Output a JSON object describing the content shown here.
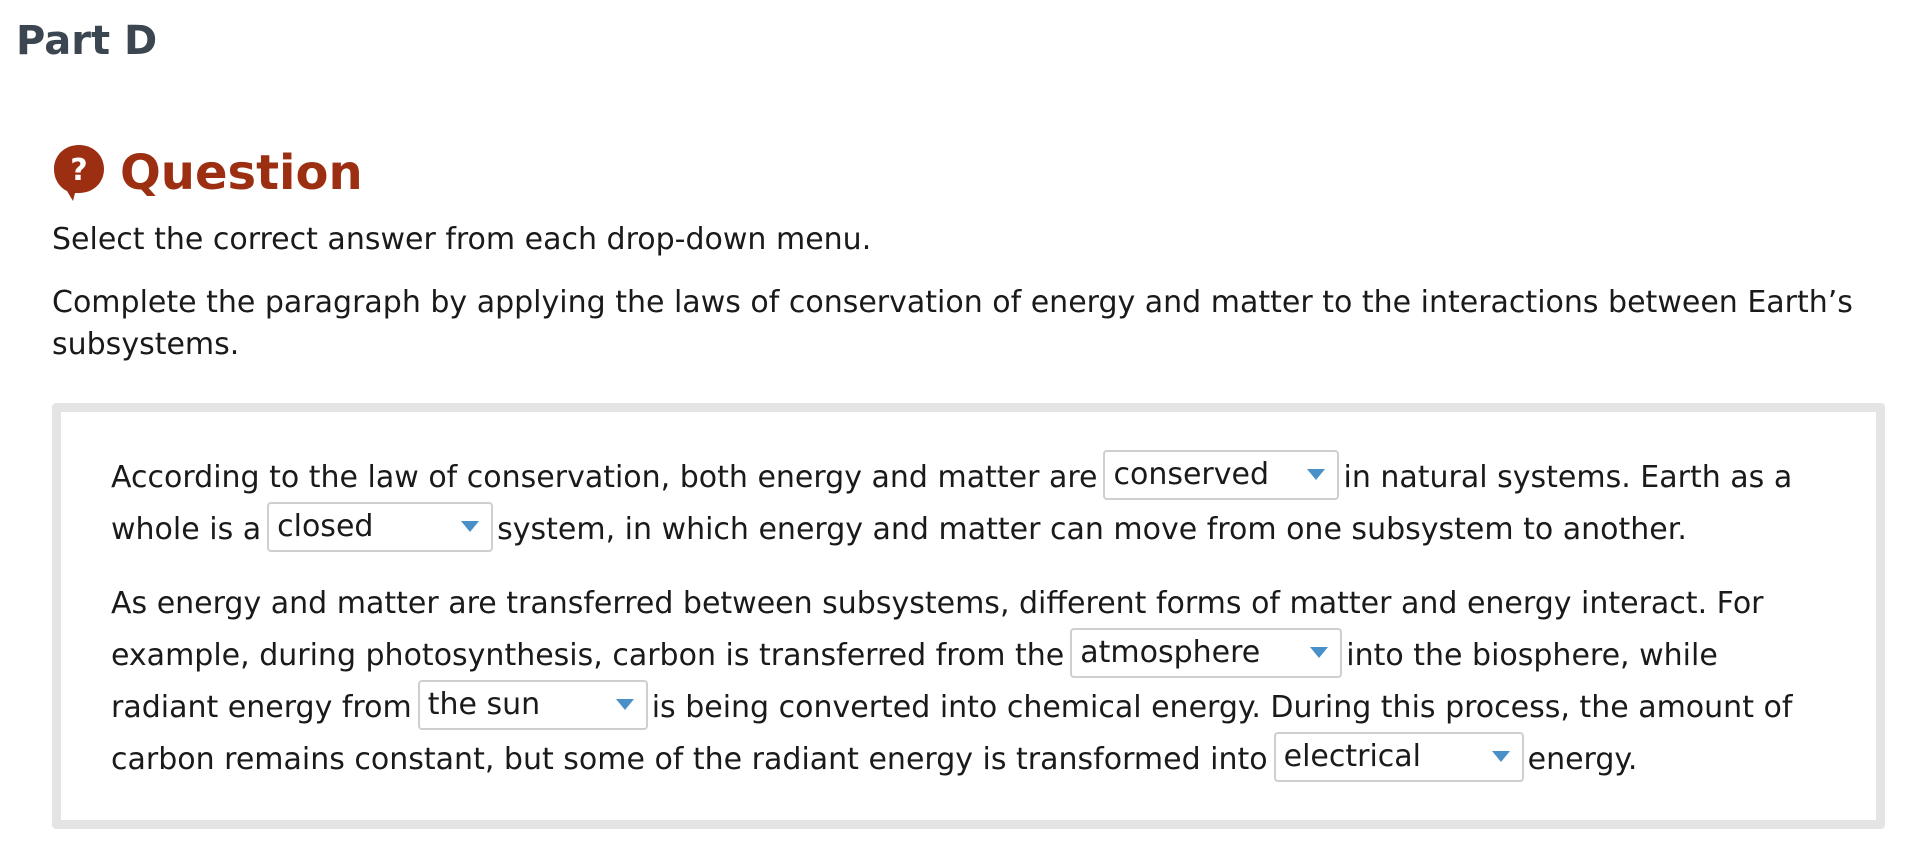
{
  "part": {
    "title": "Part D"
  },
  "question": {
    "icon": "question-mark-bubble-icon",
    "icon_glyph": "?",
    "title": "Question",
    "accent_color": "#9c2f12"
  },
  "instructions": [
    "Select the correct answer from each drop-down menu.",
    "Complete the paragraph by applying the laws of conservation of energy and matter to the interactions between Earth’s subsystems."
  ],
  "paragraph1": {
    "text_a": "According to the law of conservation, both energy and matter are",
    "dropdown_1": "conserved",
    "text_b": "in natural systems. Earth as a whole is a",
    "dropdown_2": "closed",
    "text_c": "system, in which energy and matter can move from one subsystem to another."
  },
  "paragraph2": {
    "text_a": "As energy and matter are transferred between subsystems, different forms of matter and energy interact. For example, during photosynthesis, carbon is transferred from the",
    "dropdown_3": "atmosphere",
    "text_b": "into the biosphere, while radiant energy from",
    "dropdown_4": "the sun",
    "text_c": "is being converted into chemical energy. During this process, the amount of carbon remains constant, but some of the radiant energy is transformed into",
    "dropdown_5": "electrical",
    "text_d": "energy."
  },
  "colors": {
    "part_title": "#3b4650",
    "question_title": "#9c2f12",
    "dropdown_caret": "#4a90c8",
    "box_border": "#e4e4e4"
  }
}
